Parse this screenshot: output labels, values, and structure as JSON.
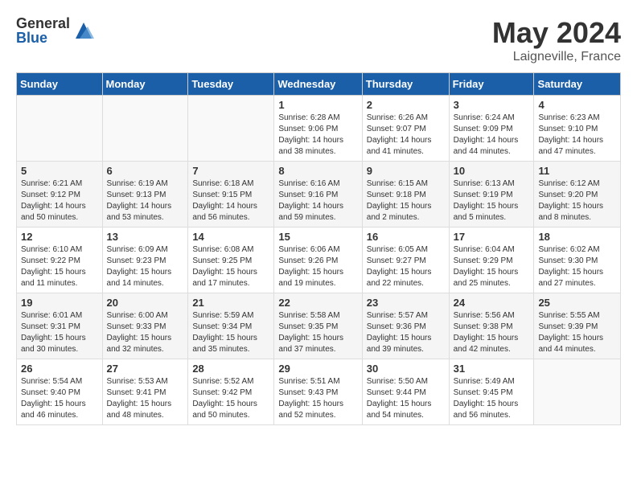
{
  "logo": {
    "general": "General",
    "blue": "Blue"
  },
  "title": "May 2024",
  "subtitle": "Laigneville, France",
  "weekdays": [
    "Sunday",
    "Monday",
    "Tuesday",
    "Wednesday",
    "Thursday",
    "Friday",
    "Saturday"
  ],
  "weeks": [
    [
      {
        "day": "",
        "info": ""
      },
      {
        "day": "",
        "info": ""
      },
      {
        "day": "",
        "info": ""
      },
      {
        "day": "1",
        "info": "Sunrise: 6:28 AM\nSunset: 9:06 PM\nDaylight: 14 hours\nand 38 minutes."
      },
      {
        "day": "2",
        "info": "Sunrise: 6:26 AM\nSunset: 9:07 PM\nDaylight: 14 hours\nand 41 minutes."
      },
      {
        "day": "3",
        "info": "Sunrise: 6:24 AM\nSunset: 9:09 PM\nDaylight: 14 hours\nand 44 minutes."
      },
      {
        "day": "4",
        "info": "Sunrise: 6:23 AM\nSunset: 9:10 PM\nDaylight: 14 hours\nand 47 minutes."
      }
    ],
    [
      {
        "day": "5",
        "info": "Sunrise: 6:21 AM\nSunset: 9:12 PM\nDaylight: 14 hours\nand 50 minutes."
      },
      {
        "day": "6",
        "info": "Sunrise: 6:19 AM\nSunset: 9:13 PM\nDaylight: 14 hours\nand 53 minutes."
      },
      {
        "day": "7",
        "info": "Sunrise: 6:18 AM\nSunset: 9:15 PM\nDaylight: 14 hours\nand 56 minutes."
      },
      {
        "day": "8",
        "info": "Sunrise: 6:16 AM\nSunset: 9:16 PM\nDaylight: 14 hours\nand 59 minutes."
      },
      {
        "day": "9",
        "info": "Sunrise: 6:15 AM\nSunset: 9:18 PM\nDaylight: 15 hours\nand 2 minutes."
      },
      {
        "day": "10",
        "info": "Sunrise: 6:13 AM\nSunset: 9:19 PM\nDaylight: 15 hours\nand 5 minutes."
      },
      {
        "day": "11",
        "info": "Sunrise: 6:12 AM\nSunset: 9:20 PM\nDaylight: 15 hours\nand 8 minutes."
      }
    ],
    [
      {
        "day": "12",
        "info": "Sunrise: 6:10 AM\nSunset: 9:22 PM\nDaylight: 15 hours\nand 11 minutes."
      },
      {
        "day": "13",
        "info": "Sunrise: 6:09 AM\nSunset: 9:23 PM\nDaylight: 15 hours\nand 14 minutes."
      },
      {
        "day": "14",
        "info": "Sunrise: 6:08 AM\nSunset: 9:25 PM\nDaylight: 15 hours\nand 17 minutes."
      },
      {
        "day": "15",
        "info": "Sunrise: 6:06 AM\nSunset: 9:26 PM\nDaylight: 15 hours\nand 19 minutes."
      },
      {
        "day": "16",
        "info": "Sunrise: 6:05 AM\nSunset: 9:27 PM\nDaylight: 15 hours\nand 22 minutes."
      },
      {
        "day": "17",
        "info": "Sunrise: 6:04 AM\nSunset: 9:29 PM\nDaylight: 15 hours\nand 25 minutes."
      },
      {
        "day": "18",
        "info": "Sunrise: 6:02 AM\nSunset: 9:30 PM\nDaylight: 15 hours\nand 27 minutes."
      }
    ],
    [
      {
        "day": "19",
        "info": "Sunrise: 6:01 AM\nSunset: 9:31 PM\nDaylight: 15 hours\nand 30 minutes."
      },
      {
        "day": "20",
        "info": "Sunrise: 6:00 AM\nSunset: 9:33 PM\nDaylight: 15 hours\nand 32 minutes."
      },
      {
        "day": "21",
        "info": "Sunrise: 5:59 AM\nSunset: 9:34 PM\nDaylight: 15 hours\nand 35 minutes."
      },
      {
        "day": "22",
        "info": "Sunrise: 5:58 AM\nSunset: 9:35 PM\nDaylight: 15 hours\nand 37 minutes."
      },
      {
        "day": "23",
        "info": "Sunrise: 5:57 AM\nSunset: 9:36 PM\nDaylight: 15 hours\nand 39 minutes."
      },
      {
        "day": "24",
        "info": "Sunrise: 5:56 AM\nSunset: 9:38 PM\nDaylight: 15 hours\nand 42 minutes."
      },
      {
        "day": "25",
        "info": "Sunrise: 5:55 AM\nSunset: 9:39 PM\nDaylight: 15 hours\nand 44 minutes."
      }
    ],
    [
      {
        "day": "26",
        "info": "Sunrise: 5:54 AM\nSunset: 9:40 PM\nDaylight: 15 hours\nand 46 minutes."
      },
      {
        "day": "27",
        "info": "Sunrise: 5:53 AM\nSunset: 9:41 PM\nDaylight: 15 hours\nand 48 minutes."
      },
      {
        "day": "28",
        "info": "Sunrise: 5:52 AM\nSunset: 9:42 PM\nDaylight: 15 hours\nand 50 minutes."
      },
      {
        "day": "29",
        "info": "Sunrise: 5:51 AM\nSunset: 9:43 PM\nDaylight: 15 hours\nand 52 minutes."
      },
      {
        "day": "30",
        "info": "Sunrise: 5:50 AM\nSunset: 9:44 PM\nDaylight: 15 hours\nand 54 minutes."
      },
      {
        "day": "31",
        "info": "Sunrise: 5:49 AM\nSunset: 9:45 PM\nDaylight: 15 hours\nand 56 minutes."
      },
      {
        "day": "",
        "info": ""
      }
    ]
  ]
}
